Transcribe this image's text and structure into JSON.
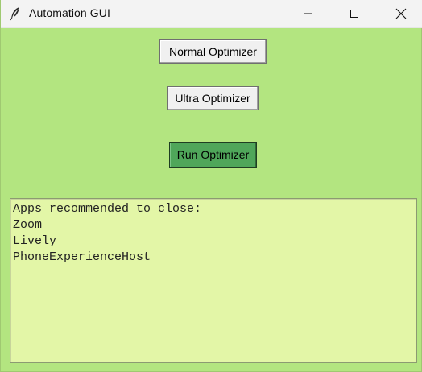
{
  "window": {
    "title": "Automation GUI",
    "icon": "feather-icon"
  },
  "buttons": {
    "normal_optimizer": "Normal Optimizer",
    "ultra_optimizer": "Ultra Optimizer",
    "run_optimizer": "Run Optimizer"
  },
  "output": {
    "lines": [
      "Apps recommended to close:",
      "Zoom",
      "Lively",
      "PhoneExperienceHost"
    ]
  },
  "colors": {
    "background": "#b3e580",
    "output_background": "#e3f6a7",
    "run_button": "#4fa65a"
  }
}
